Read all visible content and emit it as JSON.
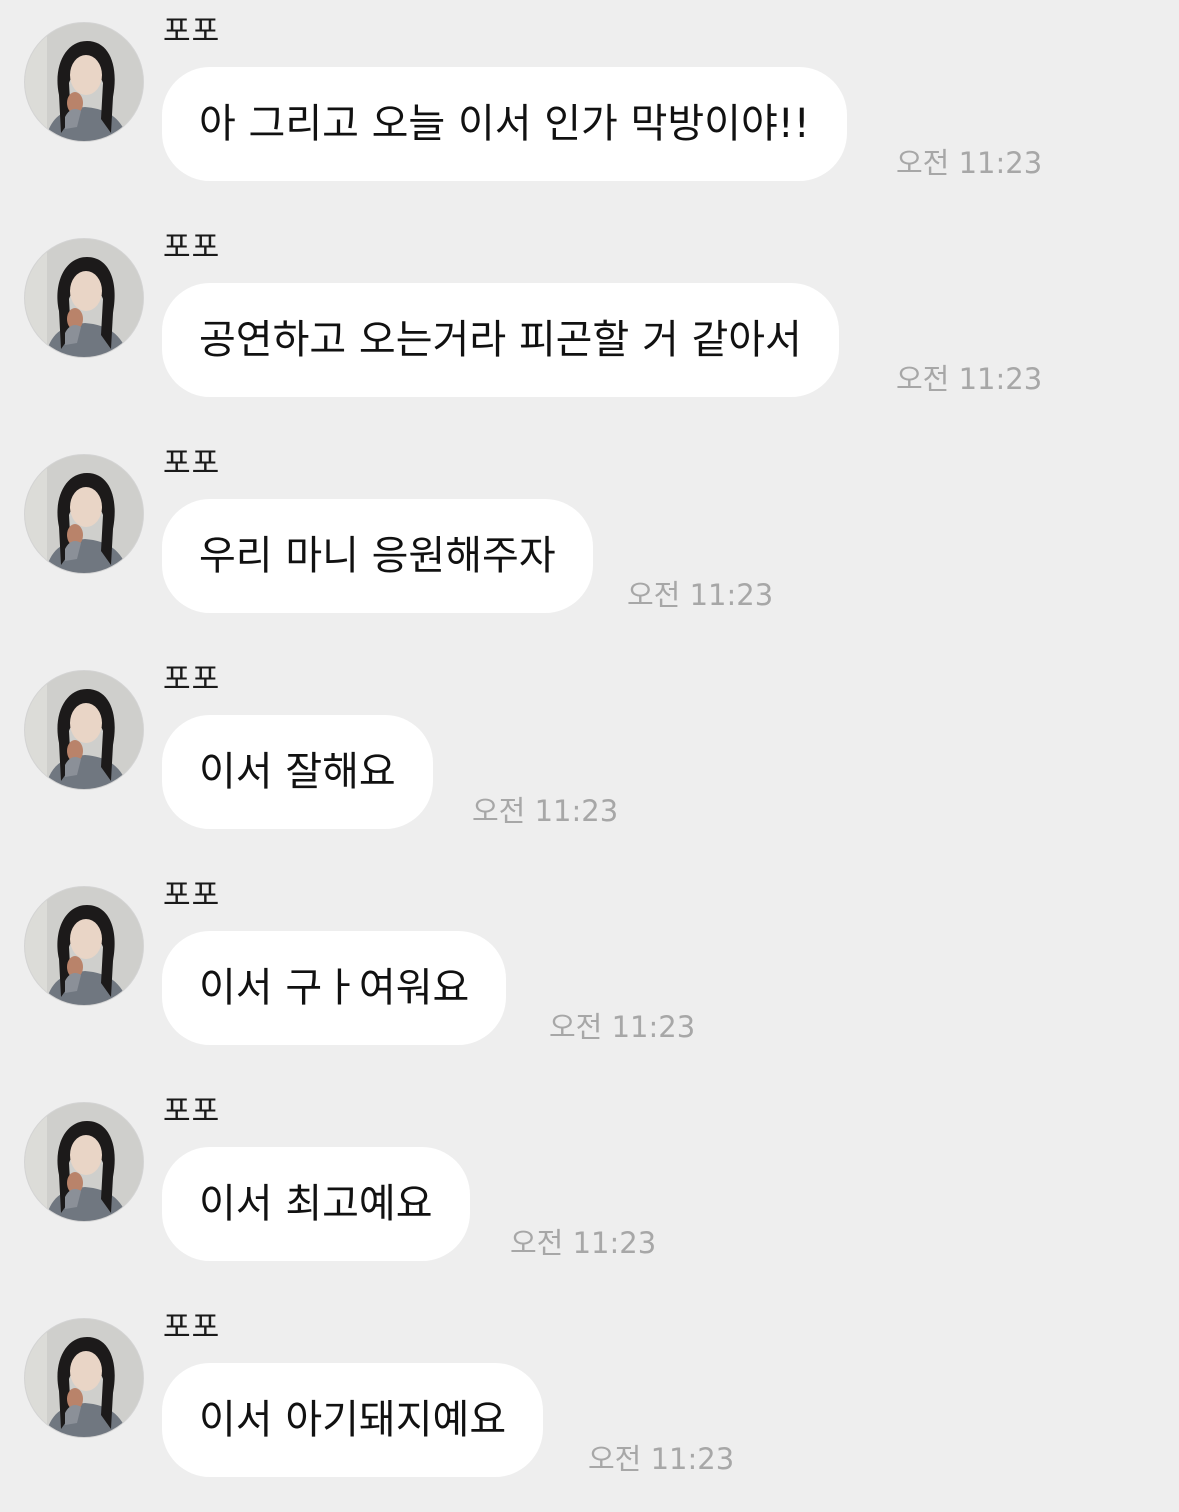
{
  "messages": [
    {
      "sender": "포포",
      "avatar_icon": "profile-photo",
      "text": "아 그리고 오늘 이서 인가 막방이야!!",
      "time": "오전 11:23"
    },
    {
      "sender": "포포",
      "avatar_icon": "profile-photo",
      "text": "공연하고 오는거라 피곤할 거 같아서",
      "time": "오전 11:23"
    },
    {
      "sender": "포포",
      "avatar_icon": "profile-photo",
      "text": "우리 마니 응원해주자",
      "time": "오전 11:23"
    },
    {
      "sender": "포포",
      "avatar_icon": "profile-photo",
      "text": "이서 잘해요",
      "time": "오전 11:23"
    },
    {
      "sender": "포포",
      "avatar_icon": "profile-photo",
      "text": "이서 구ㅏ여워요",
      "time": "오전 11:23"
    },
    {
      "sender": "포포",
      "avatar_icon": "profile-photo",
      "text": "이서 최고예요",
      "time": "오전 11:23"
    },
    {
      "sender": "포포",
      "avatar_icon": "profile-photo",
      "text": "이서 아기돼지예요",
      "time": "오전 11:23"
    }
  ],
  "colors": {
    "background": "#eeeeee",
    "bubble": "#ffffff",
    "timestamp": "#a7a7a7"
  }
}
